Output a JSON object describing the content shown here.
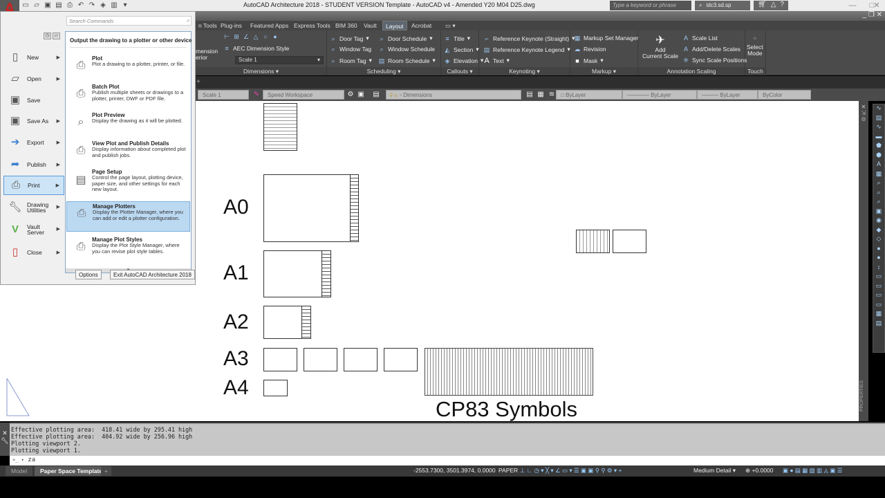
{
  "window": {
    "title": "AutoCAD Architecture 2018 - STUDENT VERSION    Template - AutoCAD v4 - Amended Y20 M04 D25.dwg",
    "logo": "A",
    "search_placeholder": "Type a keyword or phrase",
    "user": "idc3.sd.sp",
    "quick_access": [
      "new-icon",
      "open-icon",
      "save-as-icon",
      "save-icon",
      "plot-icon",
      "undo-icon",
      "redo-icon",
      "workspace-icon",
      "share-icon",
      "dropdown-icon"
    ]
  },
  "ribbon": {
    "tabs": [
      {
        "label": "n Tools"
      },
      {
        "label": "Plug-ins"
      },
      {
        "label": "Featured Apps"
      },
      {
        "label": "Express Tools"
      },
      {
        "label": "BIM 360"
      },
      {
        "label": "Vault"
      },
      {
        "label": "Layout",
        "active": true
      },
      {
        "label": "Acrobat"
      }
    ],
    "panels": {
      "dimensions": {
        "title": "Dimensions",
        "items": [
          "AEC Dimension Style"
        ],
        "left_label": "mension\nerior",
        "scale_value": "Scale 1"
      },
      "scheduling": {
        "title": "Scheduling",
        "items": [
          "Door Tag",
          "Window Tag",
          "Room Tag",
          "Door Schedule",
          "Window Schedule",
          "Room Schedule"
        ]
      },
      "callouts": {
        "title": "Callouts",
        "items": [
          "Title",
          "Section",
          "Elevation"
        ]
      },
      "keynoting": {
        "title": "Keynoting",
        "items": [
          "Reference Keynote (Straight)",
          "Reference Keynote Legend",
          "Text"
        ]
      },
      "markup": {
        "title": "Markup",
        "items": [
          "Markup Set Manager",
          "Revision",
          "Mask"
        ]
      },
      "annotation_scaling": {
        "title": "Annotation Scaling",
        "add_label": "Add\nCurrent Scale",
        "items": [
          "Scale List",
          "Add/Delete Scales",
          "Sync Scale Positions"
        ]
      },
      "touch": {
        "title": "Touch",
        "label": "Select\nMode"
      }
    }
  },
  "properties_toolbar": {
    "scale": "Scale 1",
    "workspace": "Speed Workspace",
    "layer": "Dimensions",
    "color": "ByLayer",
    "linetype": "ByLayer",
    "lineweight": "ByLayer",
    "plotstyle": "ByColor"
  },
  "app_menu": {
    "search_placeholder": "Search Commands",
    "left_items": [
      {
        "label": "New",
        "icon": "new-doc-icon"
      },
      {
        "label": "Open",
        "icon": "open-folder-icon"
      },
      {
        "label": "Save",
        "icon": "save-icon"
      },
      {
        "label": "Save As",
        "icon": "save-as-icon"
      },
      {
        "label": "Export",
        "icon": "export-icon"
      },
      {
        "label": "Publish",
        "icon": "publish-icon"
      },
      {
        "label": "Print",
        "icon": "print-icon",
        "selected": true
      },
      {
        "label": "Drawing Utilities",
        "icon": "utilities-icon"
      },
      {
        "label": "Vault Server",
        "icon": "vault-icon"
      },
      {
        "label": "Close",
        "icon": "close-doc-icon"
      }
    ],
    "heading": "Output the drawing to a plotter or other device",
    "right_items": [
      {
        "title": "Plot",
        "desc": "Plot a drawing to a plotter, printer, or file."
      },
      {
        "title": "Batch Plot",
        "desc": "Publish multiple sheets or drawings to a plotter, printer, DWF or PDF file."
      },
      {
        "title": "Plot Preview",
        "desc": "Display the drawing as it will be plotted."
      },
      {
        "title": "View Plot and Publish Details",
        "desc": "Display information about completed plot and publish jobs."
      },
      {
        "title": "Page Setup",
        "desc": "Control the page layout, plotting device, paper size, and other settings for each new layout."
      },
      {
        "title": "Manage Plotters",
        "desc": "Display the Plotter Manager, where you can add or edit a plotter configuration.",
        "selected": true
      },
      {
        "title": "Manage Plot Styles",
        "desc": "Display the Plot Style Manager, where you can revise plot style tables."
      }
    ],
    "options_label": "Options",
    "exit_label": "Exit AutoCAD Architecture 2018"
  },
  "drawing": {
    "sheet_labels": [
      "A0",
      "A1",
      "A2",
      "A3",
      "A4"
    ],
    "symbols_label": "CP83 Symbols",
    "palette_label": "PROPERTIES"
  },
  "command_line": {
    "history": [
      "Effective plotting area:  418.41 wide by 295.41 high",
      "Effective plotting area:  404.92 wide by 256.96 high",
      "Plotting viewport 2.",
      "Plotting viewport 1."
    ],
    "input": "za"
  },
  "layout_tabs": [
    {
      "label": "Model"
    },
    {
      "label": "Paper Space Template",
      "active": true
    }
  ],
  "status_bar": {
    "coordinates": "-2553.7300, 3501.3974, 0.0000",
    "space": "PAPER",
    "detail": "Medium Detail",
    "elevation": "+0.0000"
  }
}
